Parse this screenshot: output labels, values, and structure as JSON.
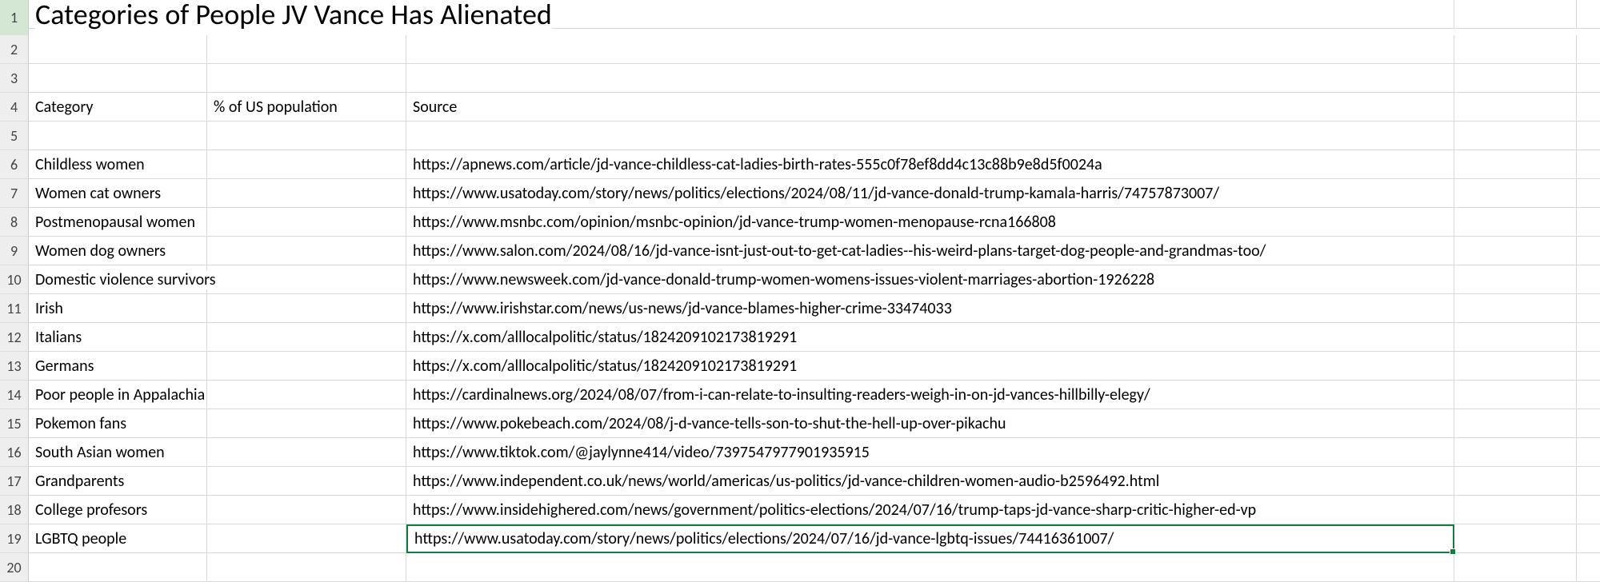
{
  "title": "Categories of People JV Vance Has Alienated",
  "headers": {
    "category": "Category",
    "pct": "% of US population",
    "source": "Source"
  },
  "rows": [
    {
      "n": 1
    },
    {
      "n": 2
    },
    {
      "n": 3
    },
    {
      "n": 4
    },
    {
      "n": 5
    },
    {
      "n": 6,
      "cat": "Childless women",
      "src": "https://apnews.com/article/jd-vance-childless-cat-ladies-birth-rates-555c0f78ef8dd4c13c88b9e8d5f0024a"
    },
    {
      "n": 7,
      "cat": "Women cat owners",
      "src": "https://www.usatoday.com/story/news/politics/elections/2024/08/11/jd-vance-donald-trump-kamala-harris/74757873007/"
    },
    {
      "n": 8,
      "cat": "Postmenopausal women",
      "src": "https://www.msnbc.com/opinion/msnbc-opinion/jd-vance-trump-women-menopause-rcna166808"
    },
    {
      "n": 9,
      "cat": "Women dog owners",
      "src": "https://www.salon.com/2024/08/16/jd-vance-isnt-just-out-to-get-cat-ladies--his-weird-plans-target-dog-people-and-grandmas-too/"
    },
    {
      "n": 10,
      "cat": "Domestic violence survivors",
      "src": "https://www.newsweek.com/jd-vance-donald-trump-women-womens-issues-violent-marriages-abortion-1926228"
    },
    {
      "n": 11,
      "cat": "Irish",
      "src": "https://www.irishstar.com/news/us-news/jd-vance-blames-higher-crime-33474033"
    },
    {
      "n": 12,
      "cat": "Italians",
      "src": "https://x.com/alllocalpolitic/status/1824209102173819291"
    },
    {
      "n": 13,
      "cat": "Germans",
      "src": "https://x.com/alllocalpolitic/status/1824209102173819291"
    },
    {
      "n": 14,
      "cat": "Poor people in Appalachia",
      "src": "https://cardinalnews.org/2024/08/07/from-i-can-relate-to-insulting-readers-weigh-in-on-jd-vances-hillbilly-elegy/"
    },
    {
      "n": 15,
      "cat": "Pokemon fans",
      "src": "https://www.pokebeach.com/2024/08/j-d-vance-tells-son-to-shut-the-hell-up-over-pikachu"
    },
    {
      "n": 16,
      "cat": "South Asian women",
      "src": "https://www.tiktok.com/@jaylynne414/video/7397547977901935915"
    },
    {
      "n": 17,
      "cat": "Grandparents",
      "src": "https://www.independent.co.uk/news/world/americas/us-politics/jd-vance-children-women-audio-b2596492.html"
    },
    {
      "n": 18,
      "cat": "College profesors",
      "src": "https://www.insidehighered.com/news/government/politics-elections/2024/07/16/trump-taps-jd-vance-sharp-critic-higher-ed-vp"
    },
    {
      "n": 19,
      "cat": "LGBTQ people",
      "src": "https://www.usatoday.com/story/news/politics/elections/2024/07/16/jd-vance-lgbtq-issues/74416361007/"
    },
    {
      "n": 20
    }
  ],
  "selected_row": 19
}
